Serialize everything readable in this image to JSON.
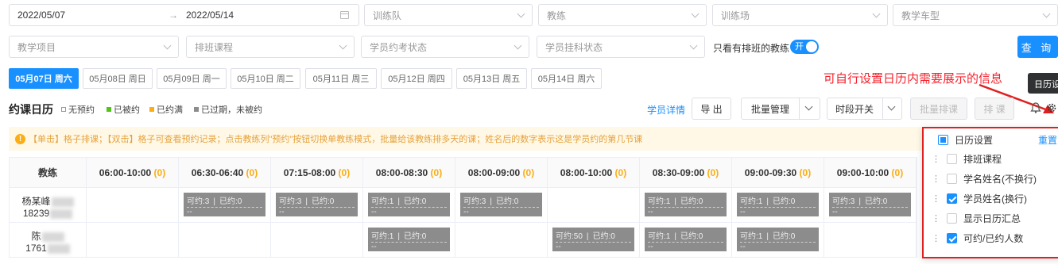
{
  "filters": {
    "date_start": "2022/05/07",
    "date_sep": "→",
    "date_end": "2022/05/14",
    "training_team": "训练队",
    "coach": "教练",
    "training_ground": "训练场",
    "vehicle_type": "教学车型",
    "teaching_item": "教学项目",
    "schedule_course": "排班课程",
    "exam_status": "学员约考状态",
    "enroll_status": "学员挂科状态",
    "only_scheduled_label": "只看有排班的教练",
    "toggle_text": "开",
    "query_button": "查 询"
  },
  "day_tabs": [
    "05月07日 周六",
    "05月08日 周日",
    "05月09日 周一",
    "05月10日 周二",
    "05月11日 周三",
    "05月12日 周四",
    "05月13日 周五",
    "05月14日 周六"
  ],
  "toolbar": {
    "title": "约课日历",
    "legend": [
      {
        "label": "无预约",
        "color": "#ffffff"
      },
      {
        "label": "已被约",
        "color": "#52c41a"
      },
      {
        "label": "已约满",
        "color": "#faad14"
      },
      {
        "label": "已过期，未被约",
        "color": "#8c8c8c"
      }
    ],
    "student_detail": "学员详情",
    "export": "导 出",
    "batch_manage": "批量管理",
    "period_switch": "时段开关",
    "batch_schedule": "批量排课",
    "schedule": "排 课"
  },
  "annotation": "可自行设置日历内需要展示的信息",
  "tooltip": "日历设",
  "notice": "【单击】格子排课；【双击】格子可查看预约记录；点击教练列\"预约\"按钮切换单教练模式，批量给该教练排多天的课；姓名后的数字表示这是学员约的第几节课",
  "grid": {
    "coach_header": "教练",
    "columns": [
      {
        "time": "06:00-10:00",
        "count": "(0)"
      },
      {
        "time": "06:30-06:40",
        "count": "(0)"
      },
      {
        "time": "07:15-08:00",
        "count": "(0)"
      },
      {
        "time": "08:00-08:30",
        "count": "(0)"
      },
      {
        "time": "08:00-09:00",
        "count": "(0)"
      },
      {
        "time": "08:00-10:00",
        "count": "(0)"
      },
      {
        "time": "08:30-09:00",
        "count": "(0)"
      },
      {
        "time": "09:00-09:30",
        "count": "(0)"
      },
      {
        "time": "09:00-10:00",
        "count": "(0)"
      }
    ],
    "rows": [
      {
        "name": "杨某峰",
        "phone": "18239",
        "slots": [
          null,
          {
            "avail": "可约:3",
            "booked": "已约:0",
            "extra": "--"
          },
          {
            "avail": "可约:3",
            "booked": "已约:0",
            "extra": "--"
          },
          {
            "avail": "可约:1",
            "booked": "已约:0",
            "extra": "--"
          },
          {
            "avail": "可约:3",
            "booked": "已约:0",
            "extra": "--"
          },
          null,
          {
            "avail": "可约:1",
            "booked": "已约:0",
            "extra": "--"
          },
          {
            "avail": "可约:1",
            "booked": "已约:0",
            "extra": "--"
          },
          {
            "avail": "可约:3",
            "booked": "已约:0",
            "extra": "--"
          }
        ]
      },
      {
        "name": "陈",
        "phone": "1761",
        "slots": [
          null,
          null,
          null,
          {
            "avail": "可约:1",
            "booked": "已约:0",
            "extra": "--"
          },
          null,
          {
            "avail": "可约:50",
            "booked": "已约:0",
            "extra": "--"
          },
          {
            "avail": "可约:1",
            "booked": "已约:0",
            "extra": "--"
          },
          {
            "avail": "可约:1",
            "booked": "已约:0",
            "extra": "--"
          },
          null
        ]
      }
    ]
  },
  "popover": {
    "title": "日历设置",
    "reset": "重置",
    "items": [
      {
        "label": "排班课程",
        "checked": false
      },
      {
        "label": "学名姓名(不换行)",
        "checked": false
      },
      {
        "label": "学员姓名(换行)",
        "checked": true
      },
      {
        "label": "显示日历汇总",
        "checked": false
      },
      {
        "label": "可约/已约人数",
        "checked": true
      }
    ]
  }
}
